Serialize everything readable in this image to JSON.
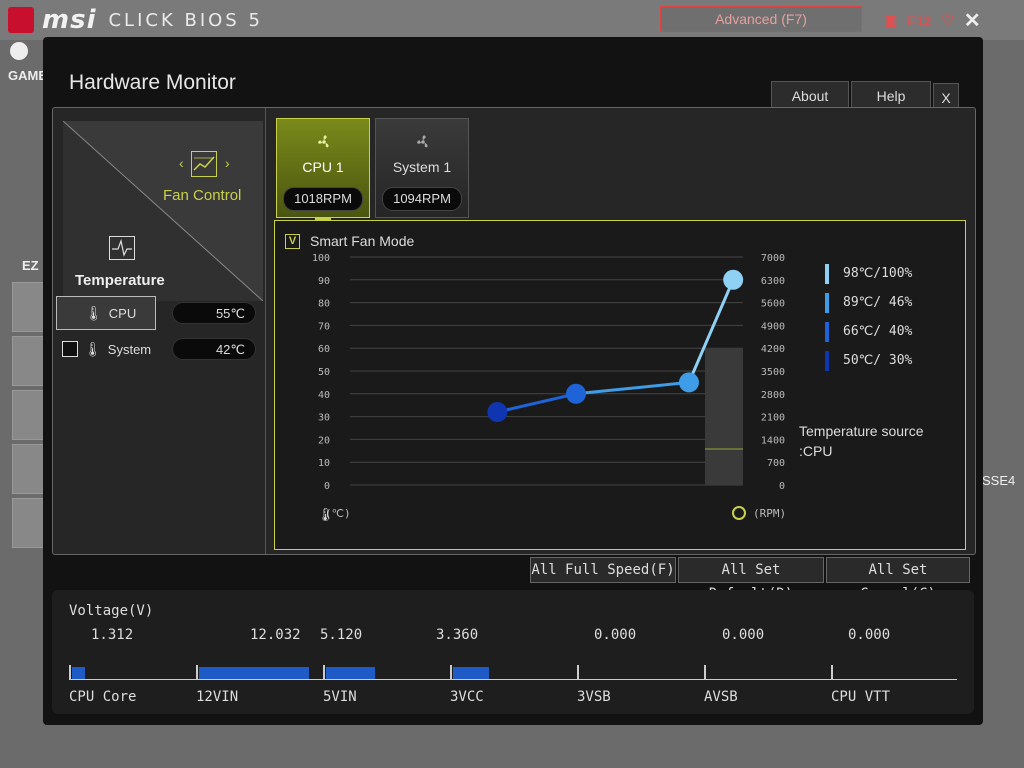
{
  "bios": {
    "brand": "msi",
    "product": "CLICK BIOS 5",
    "mode": "Advanced (F7)",
    "screenshot_key": "F12",
    "bg_left_label": "GAME",
    "bg_ez_label": "EZ",
    "bg_right_label": "SSE4"
  },
  "window": {
    "title": "Hardware Monitor",
    "buttons": {
      "about": "About",
      "help": "Help",
      "close": "X"
    }
  },
  "nav": {
    "fan_control": "Fan Control",
    "temperature": "Temperature"
  },
  "temps": [
    {
      "name": "CPU",
      "value": "55℃",
      "checked": true,
      "check": "V"
    },
    {
      "name": "System",
      "value": "42℃",
      "checked": false,
      "check": ""
    }
  ],
  "fans": [
    {
      "name": "CPU 1",
      "rpm": "1018RPM",
      "active": true
    },
    {
      "name": "System 1",
      "rpm": "1094RPM",
      "active": false
    }
  ],
  "smart_fan": {
    "label": "Smart Fan Mode",
    "check": "V"
  },
  "chart_data": {
    "type": "line",
    "title": "",
    "left_axis": {
      "label": "(℃)",
      "ticks": [
        "100",
        "90",
        "80",
        "70",
        "60",
        "50",
        "40",
        "30",
        "20",
        "10",
        "0"
      ],
      "ylim": [
        0,
        100
      ]
    },
    "right_axis": {
      "label": "(RPM)",
      "ticks": [
        "7000",
        "6300",
        "5600",
        "4900",
        "4200",
        "3500",
        "2800",
        "2100",
        "1400",
        "700",
        "0"
      ],
      "ylim": [
        0,
        7000
      ]
    },
    "series": [
      {
        "points": [
          {
            "x": 50,
            "y": 30
          },
          {
            "x": 66,
            "y": 40
          },
          {
            "x": 89,
            "y": 46
          },
          {
            "x": 98,
            "y": 100
          }
        ]
      }
    ],
    "plotted": [
      {
        "x": 50,
        "y": 32
      },
      {
        "x": 66,
        "y": 40
      },
      {
        "x": 89,
        "y": 45
      },
      {
        "x": 98,
        "y": 90
      }
    ],
    "legend": [
      {
        "text": "98℃/100%",
        "color": "#8fd0f5"
      },
      {
        "text": "89℃/ 46%",
        "color": "#3f9de8"
      },
      {
        "text": "66℃/ 40%",
        "color": "#1e64d8"
      },
      {
        "text": "50℃/ 30%",
        "color": "#1035b0"
      }
    ],
    "grid": true,
    "legend_position": "right"
  },
  "temperature_source": {
    "line1": "Temperature source",
    "line2": ":CPU"
  },
  "actions": {
    "full_speed": "All Full Speed(F)",
    "set_default": "All Set Default(D)",
    "set_cancel": "All Set Cancel(C)"
  },
  "voltage": {
    "title": "Voltage(V)",
    "items": [
      {
        "name": "CPU Core",
        "value": "1.312"
      },
      {
        "name": "12VIN",
        "value": "12.032"
      },
      {
        "name": "5VIN",
        "value": "5.120"
      },
      {
        "name": "3VCC",
        "value": "3.360"
      },
      {
        "name": "3VSB",
        "value": "0.000"
      },
      {
        "name": "AVSB",
        "value": "0.000"
      },
      {
        "name": "CPU VTT",
        "value": "0.000"
      }
    ],
    "bar_fill": [
      0.11,
      0.92,
      0.41,
      0.3,
      0,
      0,
      0
    ]
  }
}
